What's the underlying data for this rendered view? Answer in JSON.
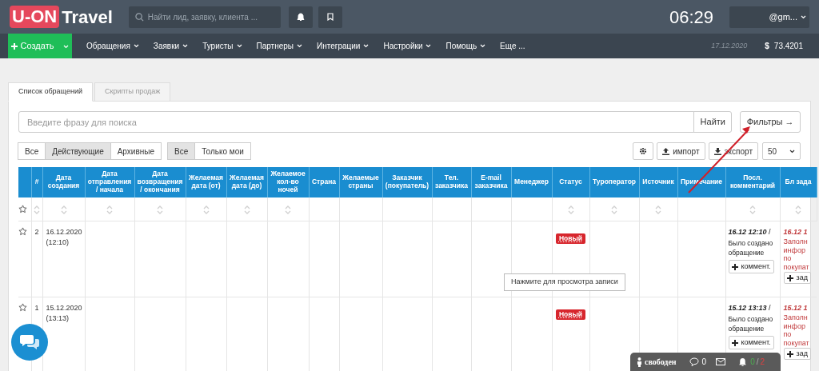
{
  "header": {
    "logo_mark": "U-ON",
    "logo_text": "Travel",
    "search": {
      "placeholder": "Найти лид, заявку, клиента ..."
    },
    "clock": "06:29",
    "user": "@gm..."
  },
  "nav": {
    "create": "Создать",
    "items": [
      "Обращения",
      "Заявки",
      "Туристы",
      "Партнеры",
      "Интеграции",
      "Настройки",
      "Помощь"
    ],
    "more": "Еще ...",
    "date": "17.12.2020",
    "currency_sign": "$",
    "rate": "73.4201"
  },
  "tabs": [
    {
      "label": "Список обращений",
      "selected": true
    },
    {
      "label": "Скрипты продаж",
      "selected": false
    }
  ],
  "search": {
    "placeholder": "Введите фразу для поиска",
    "find": "Найти",
    "filters": "Фильтры →"
  },
  "state_filter": [
    {
      "label": "Все",
      "selected": false
    },
    {
      "label": "Действующие",
      "selected": true
    },
    {
      "label": "Архивные",
      "selected": false
    }
  ],
  "owner_filter": [
    {
      "label": "Все",
      "selected": true
    },
    {
      "label": "Только мои",
      "selected": false
    }
  ],
  "toolbar": {
    "import": "импорт",
    "export": "экспорт",
    "page_size": "50"
  },
  "table": {
    "columns": [
      {
        "label": "#",
        "sortable": true
      },
      {
        "label": "Дата создания",
        "sortable": true
      },
      {
        "label": "Дата отправления / начала",
        "sortable": true
      },
      {
        "label": "Дата возвращения / окончания",
        "sortable": true
      },
      {
        "label": "Желаемая дата (от)",
        "sortable": true
      },
      {
        "label": "Желаемая дата (до)",
        "sortable": true
      },
      {
        "label": "Желаемое кол-во ночей",
        "sortable": true
      },
      {
        "label": "Страна",
        "sortable": false
      },
      {
        "label": "Желаемые страны",
        "sortable": false
      },
      {
        "label": "Заказчик (покупатель)",
        "sortable": false
      },
      {
        "label": "Тел. заказчика",
        "sortable": false
      },
      {
        "label": "E-mail заказчика",
        "sortable": false
      },
      {
        "label": "Менеджер",
        "sortable": false
      },
      {
        "label": "Статус",
        "sortable": true
      },
      {
        "label": "Туроператор",
        "sortable": true
      },
      {
        "label": "Источник",
        "sortable": true
      },
      {
        "label": "Примечание",
        "sortable": false
      },
      {
        "label": "Посл. комментарий",
        "sortable": true
      },
      {
        "label": "Бл зада",
        "sortable": true
      }
    ],
    "rows": [
      {
        "starred": false,
        "number": "2",
        "date": "16.12.2020",
        "time": "(12:10)",
        "status": "Новый",
        "comment_time": "16.12 12:10",
        "comment_sep": "/",
        "comment": "Было создано обращение",
        "comment_button": "коммент.",
        "task_time": "16.12 1",
        "task": "Заполн инфор по покупат",
        "task_button": "зад"
      },
      {
        "starred": false,
        "number": "1",
        "date": "15.12.2020",
        "time": "(13:13)",
        "status": "Новый",
        "comment_time": "15.12 13:13",
        "comment_sep": "/",
        "comment": "Было создано обращение",
        "comment_button": "коммент.",
        "task_time": "15.12 1",
        "task": "Заполн инфор по покупат",
        "task_button": "зад"
      }
    ]
  },
  "tooltip": "Нажмите для просмотра записи",
  "status_bar": {
    "presence": "свободен",
    "messages": "0",
    "notifications_read": "0",
    "separator": "/",
    "notifications_total": "2"
  }
}
